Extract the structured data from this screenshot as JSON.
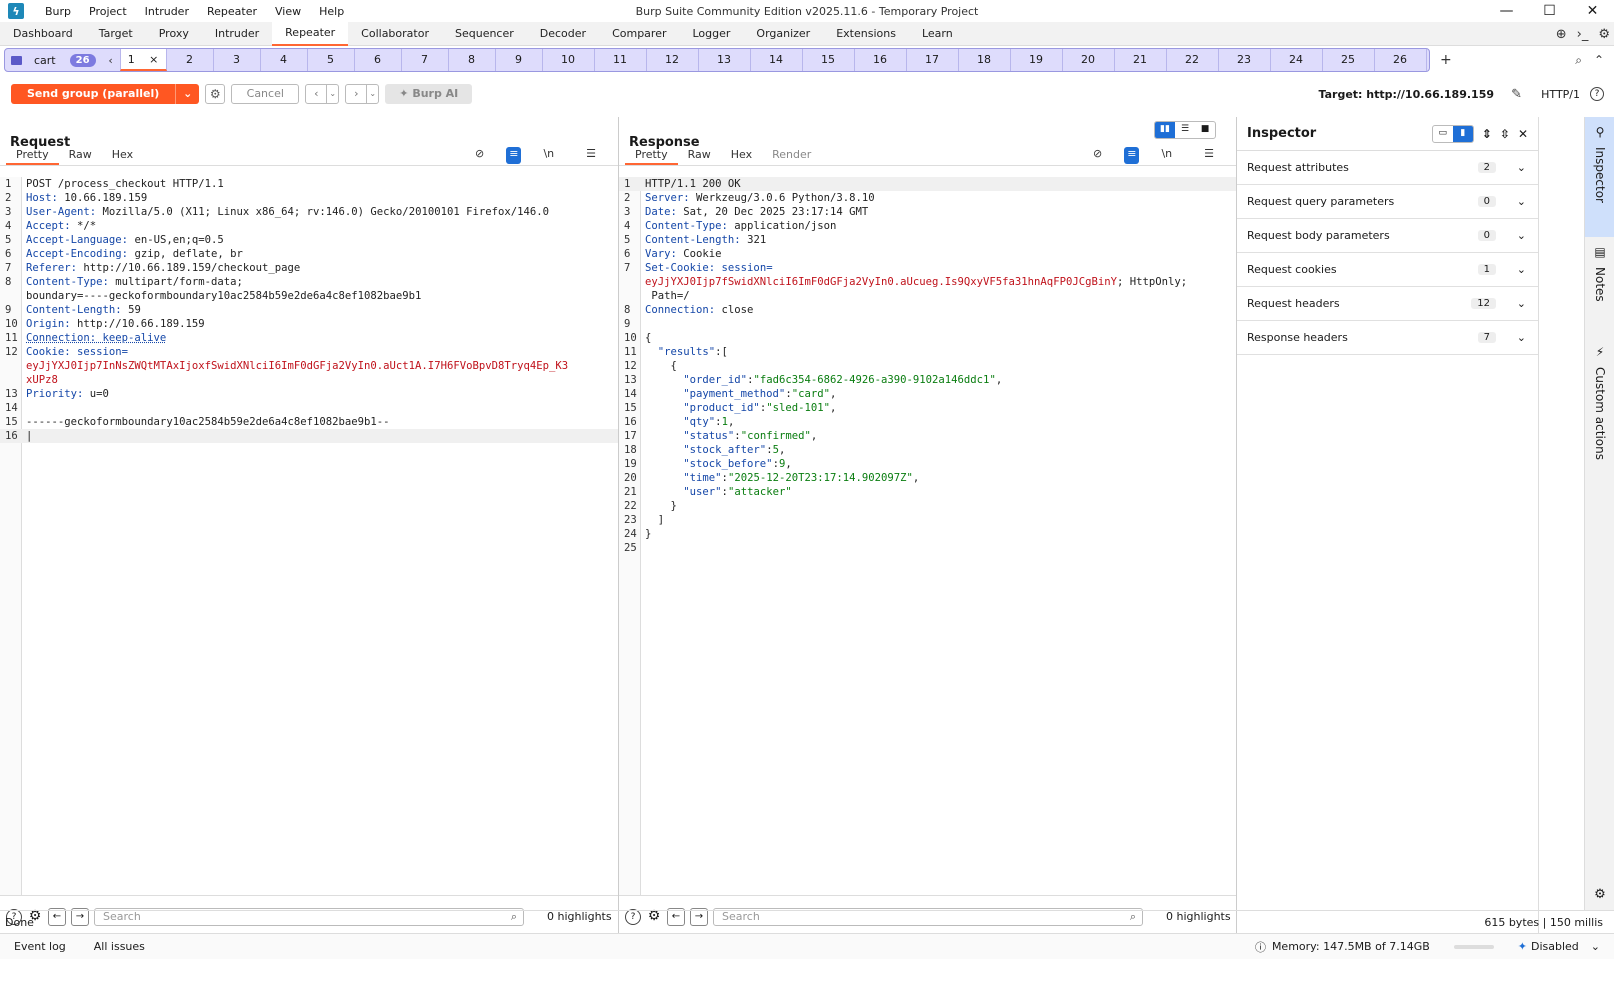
{
  "window": {
    "title": "Burp Suite Community Edition v2025.11.6 - Temporary Project",
    "menu": [
      "Burp",
      "Project",
      "Intruder",
      "Repeater",
      "View",
      "Help"
    ],
    "controls": [
      "—",
      "☐",
      "✕"
    ]
  },
  "main_tabs": [
    "Dashboard",
    "Target",
    "Proxy",
    "Intruder",
    "Repeater",
    "Collaborator",
    "Sequencer",
    "Decoder",
    "Comparer",
    "Logger",
    "Organizer",
    "Extensions",
    "Learn"
  ],
  "main_tab_active": "Repeater",
  "repeater_tabs": {
    "group_label": "cart",
    "group_count": "26",
    "first_tab": "1",
    "tabs": [
      "2",
      "3",
      "4",
      "5",
      "6",
      "7",
      "8",
      "9",
      "10",
      "11",
      "12",
      "13",
      "14",
      "15",
      "16",
      "17",
      "18",
      "19",
      "20",
      "21",
      "22",
      "23",
      "24",
      "25",
      "26"
    ]
  },
  "toolbar": {
    "send_label": "Send group (parallel)",
    "cancel_label": "Cancel",
    "ai_label": "Burp AI",
    "target_label": "Target: http://10.66.189.159",
    "http_version": "HTTP/1"
  },
  "request": {
    "title": "Request",
    "tabs": [
      "Pretty",
      "Raw",
      "Hex"
    ],
    "lines": [
      {
        "n": "1",
        "segs": [
          {
            "t": "POST /process_checkout HTTP/1.1",
            "c": "hv"
          }
        ]
      },
      {
        "n": "2",
        "segs": [
          {
            "t": "Host: ",
            "c": "hk"
          },
          {
            "t": "10.66.189.159",
            "c": "hv"
          }
        ]
      },
      {
        "n": "3",
        "segs": [
          {
            "t": "User-Agent: ",
            "c": "hk"
          },
          {
            "t": "Mozilla/5.0 (X11; Linux x86_64; rv:146.0) Gecko/20100101 Firefox/146.0",
            "c": "hv"
          }
        ]
      },
      {
        "n": "4",
        "segs": [
          {
            "t": "Accept: ",
            "c": "hk"
          },
          {
            "t": "*/*",
            "c": "hv"
          }
        ]
      },
      {
        "n": "5",
        "segs": [
          {
            "t": "Accept-Language: ",
            "c": "hk"
          },
          {
            "t": "en-US,en;q=0.5",
            "c": "hv"
          }
        ]
      },
      {
        "n": "6",
        "segs": [
          {
            "t": "Accept-Encoding: ",
            "c": "hk"
          },
          {
            "t": "gzip, deflate, br",
            "c": "hv"
          }
        ]
      },
      {
        "n": "7",
        "segs": [
          {
            "t": "Referer: ",
            "c": "hk"
          },
          {
            "t": "http://10.66.189.159/checkout_page",
            "c": "hv"
          }
        ]
      },
      {
        "n": "8",
        "segs": [
          {
            "t": "Content-Type: ",
            "c": "hk"
          },
          {
            "t": "multipart/form-data;",
            "c": "hv"
          }
        ]
      },
      {
        "n": "",
        "segs": [
          {
            "t": "boundary=----geckoformboundary10ac2584b59e2de6a4c8ef1082bae9b1",
            "c": "hv"
          }
        ]
      },
      {
        "n": "9",
        "segs": [
          {
            "t": "Content-Length: ",
            "c": "hk"
          },
          {
            "t": "59",
            "c": "hv"
          }
        ]
      },
      {
        "n": "10",
        "segs": [
          {
            "t": "Origin: ",
            "c": "hk"
          },
          {
            "t": "http://10.66.189.159",
            "c": "hv"
          }
        ]
      },
      {
        "n": "11",
        "segs": [
          {
            "t": "Connection: keep-alive",
            "c": "hk dotu"
          }
        ]
      },
      {
        "n": "12",
        "segs": [
          {
            "t": "Cookie: ",
            "c": "hk"
          },
          {
            "t": "session=",
            "c": "hk"
          }
        ]
      },
      {
        "n": "",
        "segs": [
          {
            "t": "eyJjYXJ0Ijp7InNsZWQtMTAxIjoxfSwidXNlciI6ImF0dGFja2VyIn0.aUct1A.I7H6FVoBpvD8Tryq4Ep_K3",
            "c": "red"
          }
        ]
      },
      {
        "n": "",
        "segs": [
          {
            "t": "xUPz8",
            "c": "red"
          }
        ]
      },
      {
        "n": "13",
        "segs": [
          {
            "t": "Priority: ",
            "c": "hk"
          },
          {
            "t": "u=0",
            "c": "hv"
          }
        ]
      },
      {
        "n": "14",
        "segs": [
          {
            "t": "",
            "c": "hv"
          }
        ]
      },
      {
        "n": "15",
        "segs": [
          {
            "t": "------geckoformboundary10ac2584b59e2de6a4c8ef1082bae9b1--",
            "c": "hv"
          }
        ]
      },
      {
        "n": "16",
        "segs": [
          {
            "t": "|",
            "c": "hv"
          }
        ]
      }
    ],
    "search_placeholder": "Search",
    "highlights": "0 highlights"
  },
  "response": {
    "title": "Response",
    "tabs": [
      "Pretty",
      "Raw",
      "Hex",
      "Render"
    ],
    "lines": [
      {
        "n": "1",
        "segs": [
          {
            "t": "HTTP/1.1 200 OK",
            "c": "hv"
          }
        ]
      },
      {
        "n": "2",
        "segs": [
          {
            "t": "Server: ",
            "c": "hk"
          },
          {
            "t": "Werkzeug/3.0.6 Python/3.8.10",
            "c": "hv"
          }
        ]
      },
      {
        "n": "3",
        "segs": [
          {
            "t": "Date: ",
            "c": "hk"
          },
          {
            "t": "Sat, 20 Dec 2025 23:17:14 GMT",
            "c": "hv"
          }
        ]
      },
      {
        "n": "4",
        "segs": [
          {
            "t": "Content-Type: ",
            "c": "hk"
          },
          {
            "t": "application/json",
            "c": "hv"
          }
        ]
      },
      {
        "n": "5",
        "segs": [
          {
            "t": "Content-Length: ",
            "c": "hk"
          },
          {
            "t": "321",
            "c": "hv"
          }
        ]
      },
      {
        "n": "6",
        "segs": [
          {
            "t": "Vary: ",
            "c": "hk"
          },
          {
            "t": "Cookie",
            "c": "hv"
          }
        ]
      },
      {
        "n": "7",
        "segs": [
          {
            "t": "Set-Cookie: ",
            "c": "hk"
          },
          {
            "t": "session=",
            "c": "hk"
          }
        ]
      },
      {
        "n": "",
        "segs": [
          {
            "t": "eyJjYXJ0Ijp7fSwidXNlciI6ImF0dGFja2VyIn0.aUcueg.Is9QxyVF5fa31hnAqFP0JCgBinY",
            "c": "red"
          },
          {
            "t": "; HttpOnly;",
            "c": "hv"
          }
        ]
      },
      {
        "n": "",
        "segs": [
          {
            "t": " Path=/",
            "c": "hv"
          }
        ]
      },
      {
        "n": "8",
        "segs": [
          {
            "t": "Connection: ",
            "c": "hk"
          },
          {
            "t": "close",
            "c": "hv"
          }
        ]
      },
      {
        "n": "9",
        "segs": [
          {
            "t": "",
            "c": "hv"
          }
        ]
      },
      {
        "n": "10",
        "segs": [
          {
            "t": "{",
            "c": "hv"
          }
        ]
      },
      {
        "n": "11",
        "segs": [
          {
            "t": "  \"results\"",
            "c": "jk"
          },
          {
            "t": ":[",
            "c": "hv"
          }
        ]
      },
      {
        "n": "12",
        "segs": [
          {
            "t": "    {",
            "c": "hv"
          }
        ]
      },
      {
        "n": "13",
        "segs": [
          {
            "t": "      \"order_id\"",
            "c": "jk"
          },
          {
            "t": ":",
            "c": "hv"
          },
          {
            "t": "\"fad6c354-6862-4926-a390-9102a146ddc1\"",
            "c": "grn"
          },
          {
            "t": ",",
            "c": "hv"
          }
        ]
      },
      {
        "n": "14",
        "segs": [
          {
            "t": "      \"payment_method\"",
            "c": "jk"
          },
          {
            "t": ":",
            "c": "hv"
          },
          {
            "t": "\"card\"",
            "c": "grn"
          },
          {
            "t": ",",
            "c": "hv"
          }
        ]
      },
      {
        "n": "15",
        "segs": [
          {
            "t": "      \"product_id\"",
            "c": "jk"
          },
          {
            "t": ":",
            "c": "hv"
          },
          {
            "t": "\"sled-101\"",
            "c": "grn"
          },
          {
            "t": ",",
            "c": "hv"
          }
        ]
      },
      {
        "n": "16",
        "segs": [
          {
            "t": "      \"qty\"",
            "c": "jk"
          },
          {
            "t": ":",
            "c": "hv"
          },
          {
            "t": "1",
            "c": "grn"
          },
          {
            "t": ",",
            "c": "hv"
          }
        ]
      },
      {
        "n": "17",
        "segs": [
          {
            "t": "      \"status\"",
            "c": "jk"
          },
          {
            "t": ":",
            "c": "hv"
          },
          {
            "t": "\"confirmed\"",
            "c": "grn"
          },
          {
            "t": ",",
            "c": "hv"
          }
        ]
      },
      {
        "n": "18",
        "segs": [
          {
            "t": "      \"stock_after\"",
            "c": "jk"
          },
          {
            "t": ":",
            "c": "hv"
          },
          {
            "t": "5",
            "c": "grn"
          },
          {
            "t": ",",
            "c": "hv"
          }
        ]
      },
      {
        "n": "19",
        "segs": [
          {
            "t": "      \"stock_before\"",
            "c": "jk"
          },
          {
            "t": ":",
            "c": "hv"
          },
          {
            "t": "9",
            "c": "grn"
          },
          {
            "t": ",",
            "c": "hv"
          }
        ]
      },
      {
        "n": "20",
        "segs": [
          {
            "t": "      \"time\"",
            "c": "jk"
          },
          {
            "t": ":",
            "c": "hv"
          },
          {
            "t": "\"2025-12-20T23:17:14.902097Z\"",
            "c": "grn"
          },
          {
            "t": ",",
            "c": "hv"
          }
        ]
      },
      {
        "n": "21",
        "segs": [
          {
            "t": "      \"user\"",
            "c": "jk"
          },
          {
            "t": ":",
            "c": "hv"
          },
          {
            "t": "\"attacker\"",
            "c": "grn"
          }
        ]
      },
      {
        "n": "22",
        "segs": [
          {
            "t": "    }",
            "c": "hv"
          }
        ]
      },
      {
        "n": "23",
        "segs": [
          {
            "t": "  ]",
            "c": "hv"
          }
        ]
      },
      {
        "n": "24",
        "segs": [
          {
            "t": "}",
            "c": "hv"
          }
        ]
      },
      {
        "n": "25",
        "segs": [
          {
            "t": "",
            "c": "hv"
          }
        ]
      }
    ],
    "search_placeholder": "Search",
    "highlights": "0 highlights"
  },
  "inspector": {
    "title": "Inspector",
    "rows": [
      {
        "label": "Request attributes",
        "count": "2"
      },
      {
        "label": "Request query parameters",
        "count": "0"
      },
      {
        "label": "Request body parameters",
        "count": "0"
      },
      {
        "label": "Request cookies",
        "count": "1"
      },
      {
        "label": "Request headers",
        "count": "12"
      },
      {
        "label": "Response headers",
        "count": "7"
      }
    ]
  },
  "sidebar": {
    "items": [
      "Inspector",
      "Notes",
      "Custom actions"
    ]
  },
  "status": {
    "left": "Done",
    "right": "615 bytes | 150 millis"
  },
  "bottom": {
    "tabs": [
      "Event log",
      "All issues"
    ],
    "memory": "Memory: 147.5MB of 7.14GB",
    "ai_state": "Disabled"
  },
  "colors": {
    "accent": "#ff5722",
    "tab_group_bg": "#dedcfc",
    "link_blue": "#1f6fd6"
  }
}
